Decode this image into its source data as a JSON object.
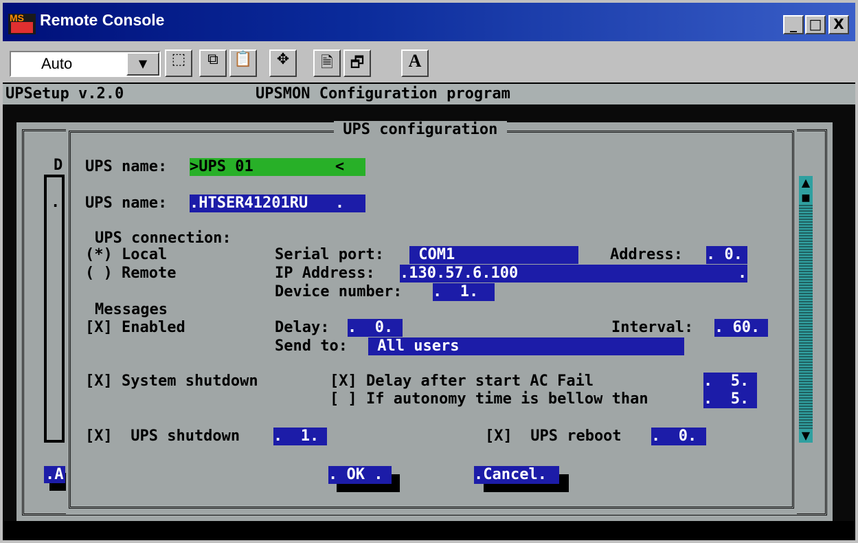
{
  "window": {
    "title": "Remote Console",
    "app_icon_label": "MS",
    "min": "_",
    "max": "□",
    "close": "X"
  },
  "toolbar": {
    "zoom_value": "Auto",
    "dropdown_arrow": "▼",
    "select_icon": "⬚",
    "copy_icon": "⧉",
    "paste_icon": "📋",
    "fullscreen_icon": "✥",
    "properties_icon": "🗎",
    "window_icon": "🗗",
    "font_icon": "A"
  },
  "header": {
    "version": "UPSetup v.2.0",
    "program": "UPSMON Configuration program"
  },
  "dialog": {
    "title": " UPS configuration ",
    "back_letter_d": "D",
    "back_button_a": ".A",
    "back_dot": ".",
    "name_label_1": "UPS name:",
    "name_value_1": ">UPS 01         <",
    "name_label_2": "UPS name:",
    "name_value_2": ".HTSER41201RU   .",
    "connection_label": "UPS connection:",
    "local_option": "(*) Local",
    "remote_option": "( ) Remote",
    "serial_label": "Serial port:",
    "serial_value": " COM1",
    "address_label": "Address:",
    "address_value": ". 0.",
    "ip_label": "IP Address:",
    "ip_value": ".130.57.6.100",
    "ip_end": ".",
    "device_label": "Device number:",
    "device_value": ".  1.",
    "messages_label": "Messages",
    "enabled_option": "[X] Enabled",
    "delay_label": "Delay:",
    "delay_value": ".  0.",
    "interval_label": "Interval:",
    "interval_value": ". 60.",
    "send_label": "Send to:",
    "send_value": " All users",
    "system_shutdown": "[X] System shutdown",
    "delay_ac": "[X] Delay after start AC Fail",
    "delay_ac_value": ".  5.",
    "autonomy": "[ ] If autonomy time is bellow than",
    "autonomy_value": ".  5.",
    "ups_shutdown": "[X]  UPS shutdown",
    "ups_shutdown_value": ".  1.",
    "ups_reboot": "[X]  UPS reboot",
    "ups_reboot_value": ".  0.",
    "ok_label": ". OK .",
    "cancel_label": ".Cancel."
  },
  "scrollbar": {
    "up": "▲",
    "down": "▼",
    "thumb": "■"
  }
}
